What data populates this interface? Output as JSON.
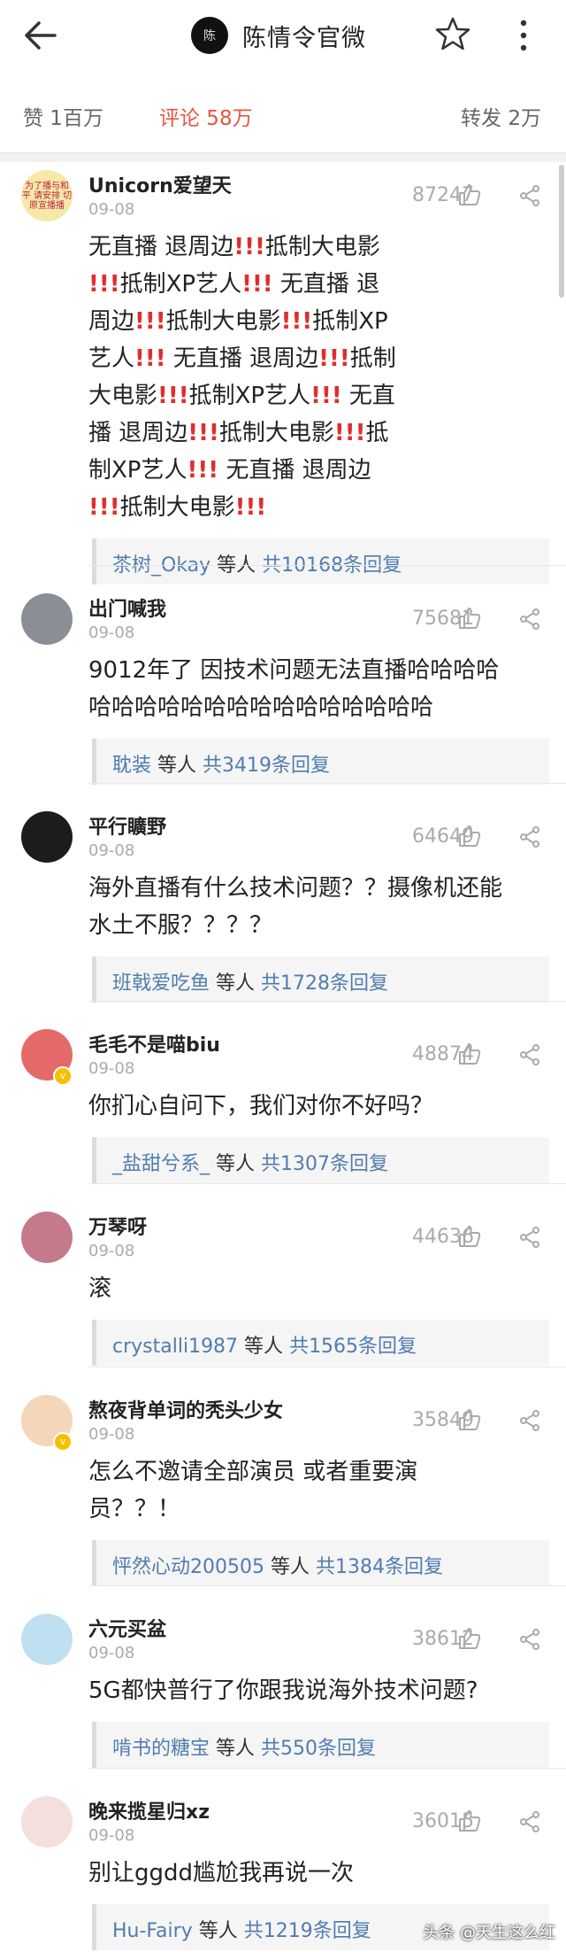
{
  "header": {
    "title": "陈情令官微",
    "logo_text": "陈"
  },
  "stats": {
    "likes": "赞  1百万",
    "comments": "评论  58万",
    "reposts": "转发  2万"
  },
  "comments": [
    {
      "name": "Unicorn爱望天",
      "date": "09-08",
      "likes": "87247",
      "avatar_color": "#f6e8a8",
      "avatar_text": "为了播与和平 请安排 切原宣播播",
      "verified": false,
      "lines": [
        "无直播 退周边❗❗❗抵制大电影",
        "❗❗❗抵制XP艺人❗❗❗ 无直播 退",
        "周边❗❗❗抵制大电影❗❗❗抵制XP",
        "艺人❗❗❗ 无直播 退周边❗❗❗抵制",
        "大电影❗❗❗抵制XP艺人❗❗❗ 无直",
        "播 退周边❗❗❗抵制大电影❗❗❗抵",
        "制XP艺人❗❗❗ 无直播 退周边",
        "❗❗❗抵制大电影❗❗❗"
      ],
      "reply_name": "茶树_Okay",
      "reply_mid": " 等人 ",
      "reply_count": "共10168条回复"
    },
    {
      "name": "出门喊我",
      "date": "09-08",
      "likes": "75681",
      "avatar_color": "#8a8e95",
      "avatar_text": "",
      "verified": false,
      "lines": [
        "9012年了 因技术问题无法直播哈哈哈哈",
        "哈哈哈哈哈哈哈哈哈哈哈哈哈哈哈"
      ],
      "reply_name": "耽装",
      "reply_mid": " 等人 ",
      "reply_count": "共3419条回复"
    },
    {
      "name": "平行矌野",
      "date": "09-08",
      "likes": "64649",
      "avatar_color": "#1c1c1c",
      "avatar_text": "",
      "verified": false,
      "lines": [
        "海外直播有什么技术问题？？摄像机还能",
        "水土不服？？？？"
      ],
      "reply_name": "班戟爱吃鱼",
      "reply_mid": " 等人 ",
      "reply_count": "共1728条回复"
    },
    {
      "name": "毛毛不是喵biu",
      "date": "09-08",
      "likes": "48874",
      "avatar_color": "#e46a6a",
      "avatar_text": "",
      "verified": true,
      "lines": [
        "你扪心自问下，我们对你不好吗？"
      ],
      "reply_name": "_盐甜兮系_",
      "reply_mid": " 等人 ",
      "reply_count": "共1307条回复"
    },
    {
      "name": "万琴呀",
      "date": "09-08",
      "likes": "44636",
      "avatar_color": "#c47a8a",
      "avatar_text": "",
      "verified": false,
      "lines": [
        "滚"
      ],
      "reply_name": "crystalli1987",
      "reply_mid": " 等人 ",
      "reply_count": "共1565条回复"
    },
    {
      "name": "熬夜背单词的秃头少女",
      "date": "09-08",
      "likes": "35849",
      "avatar_color": "#f3d7b8",
      "avatar_text": "",
      "verified": true,
      "lines": [
        "怎么不邀请全部演员 或者重要演",
        "员？？！"
      ],
      "reply_name": "怦然心动200505",
      "reply_mid": " 等人 ",
      "reply_count": "共1384条回复"
    },
    {
      "name": "六元买盆",
      "date": "09-08",
      "likes": "38612",
      "avatar_color": "#bfe0f0",
      "avatar_text": "",
      "verified": false,
      "lines": [
        "5G都快普行了你跟我说海外技术问题?"
      ],
      "reply_name": "啃书的糖宝",
      "reply_mid": " 等人 ",
      "reply_count": "共550条回复"
    },
    {
      "name": "晚来揽星归xz",
      "date": "09-08",
      "likes": "36015",
      "avatar_color": "#f4dede",
      "avatar_text": "",
      "verified": false,
      "lines": [
        "别让ggdd尴尬我再说一次"
      ],
      "reply_name": "Hu-Fairy",
      "reply_mid": " 等人 ",
      "reply_count": "共1219条回复"
    }
  ],
  "watermark": "头条 @天生这么红"
}
